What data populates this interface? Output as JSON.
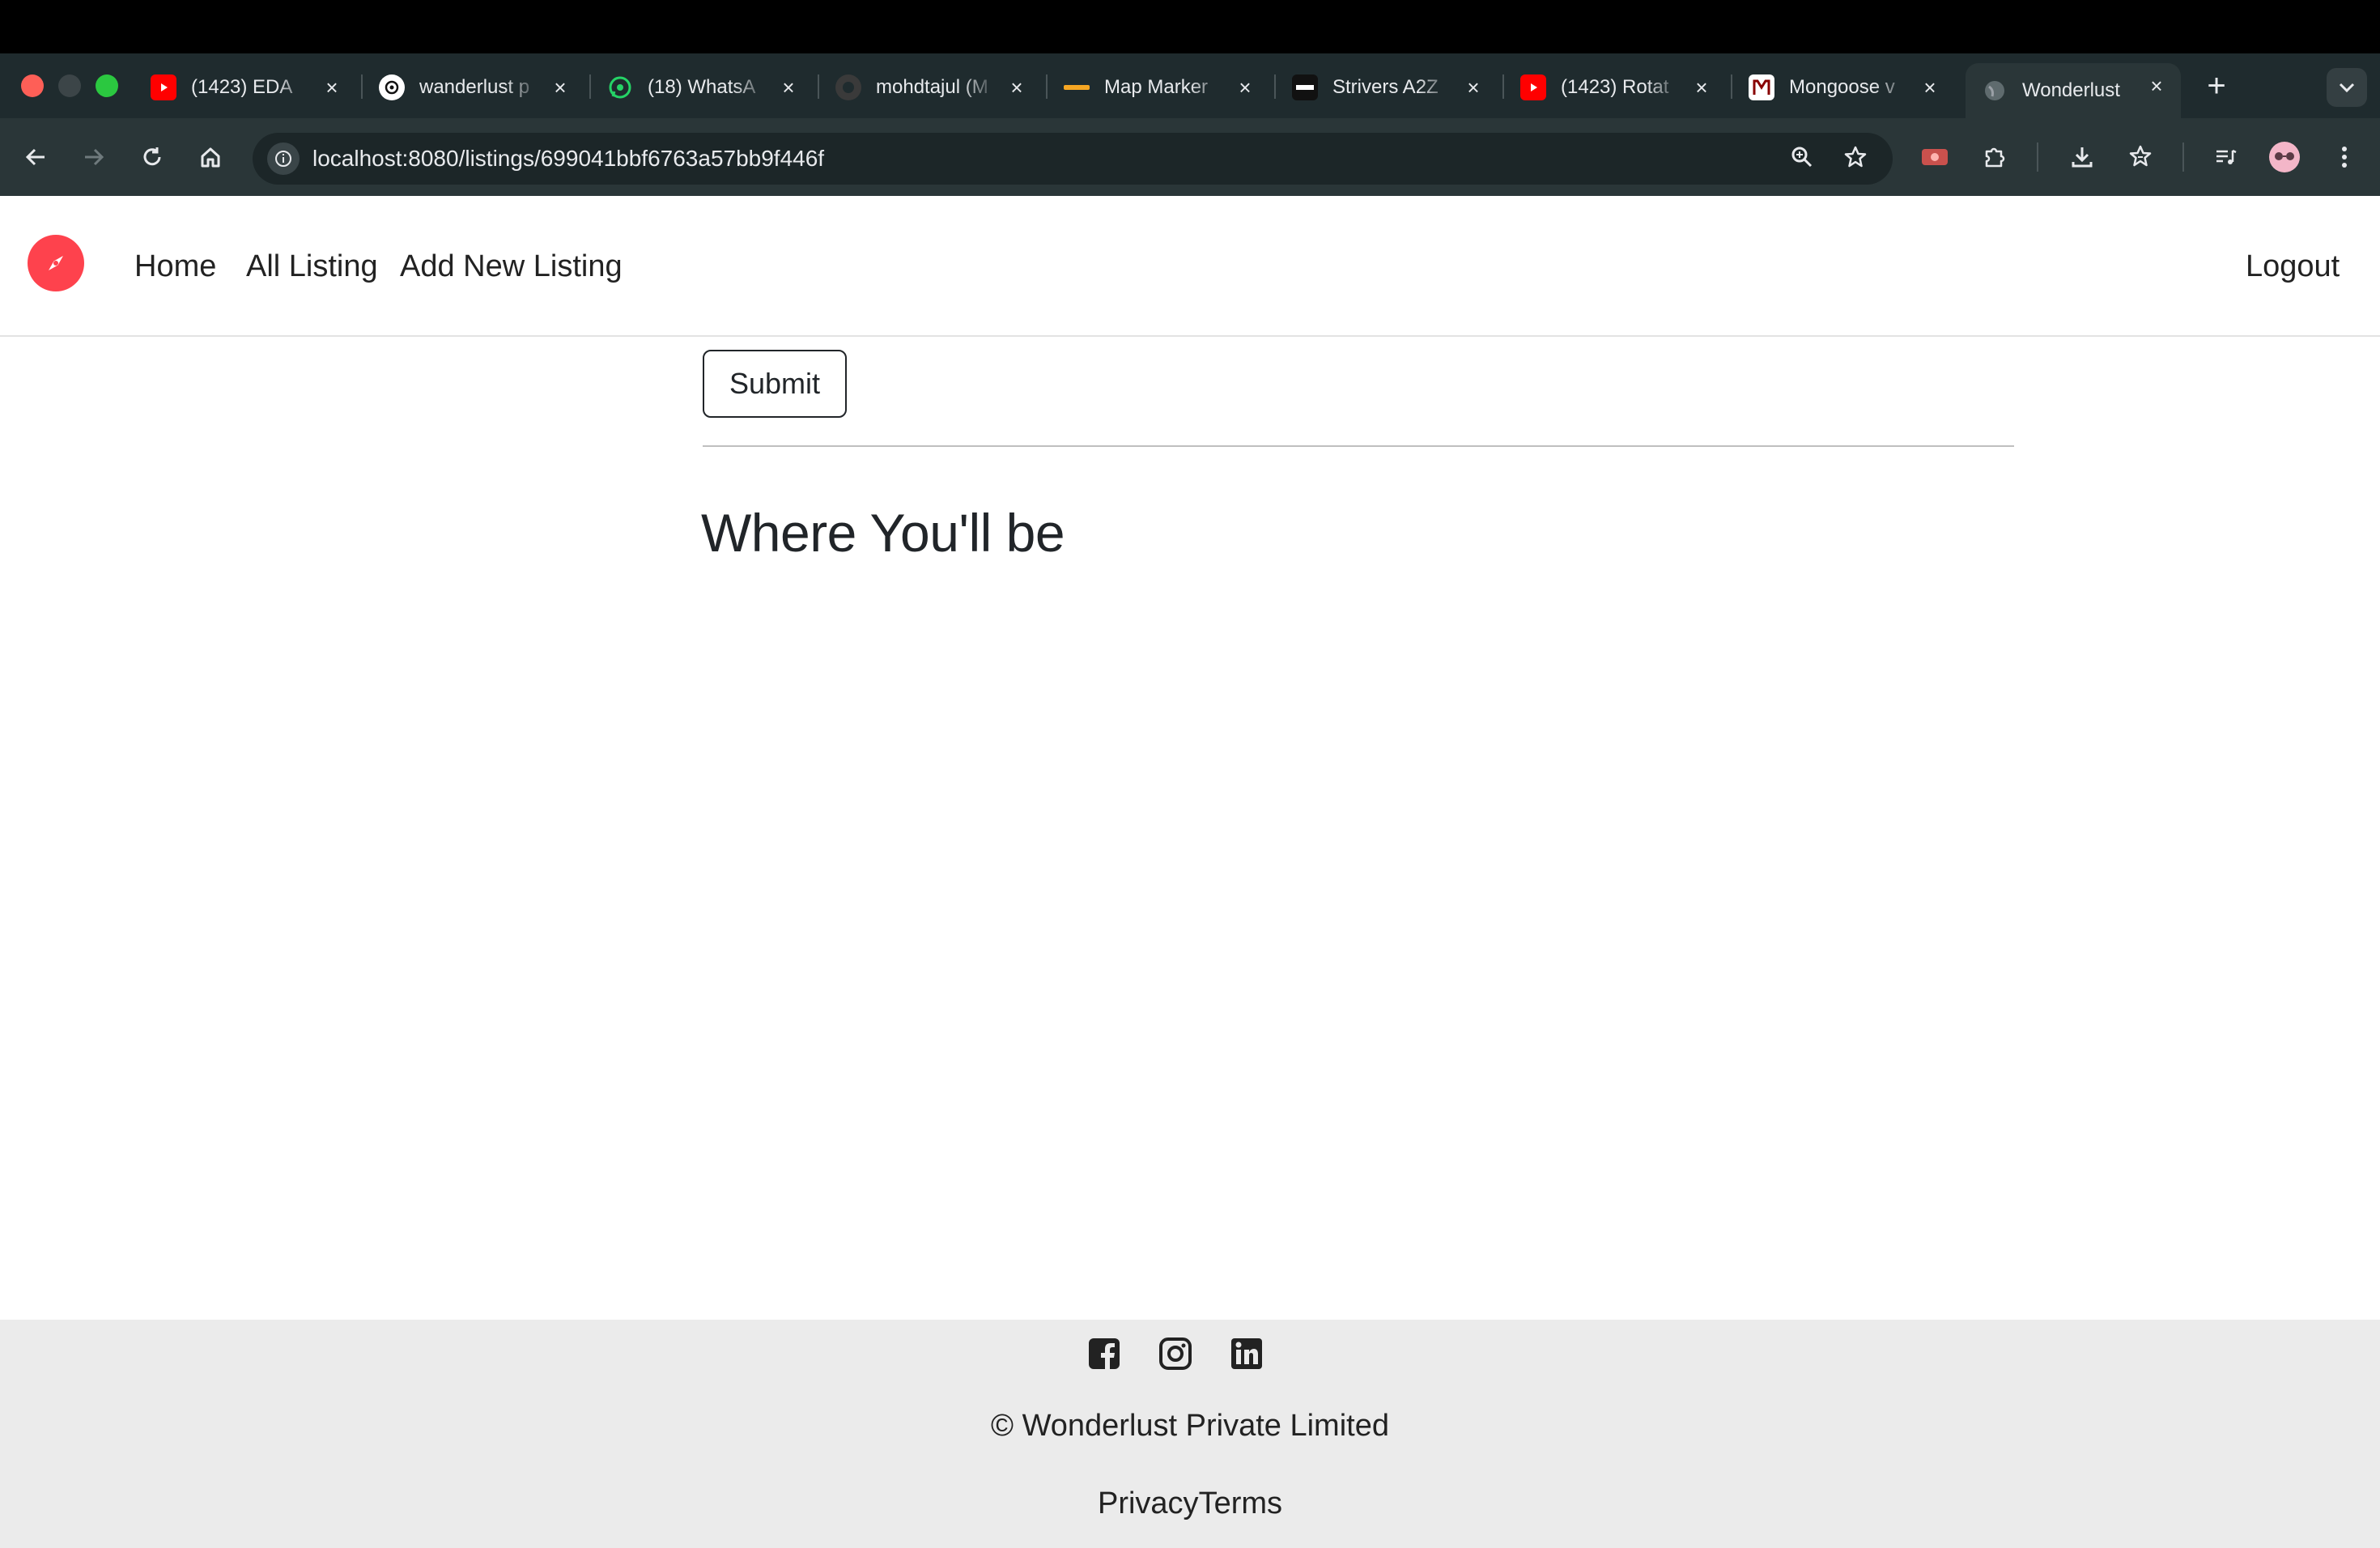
{
  "browser": {
    "tabs": [
      {
        "title": "(1423) EDA",
        "icon": "youtube-icon",
        "color": "#ff0000"
      },
      {
        "title": "wanderlust p",
        "icon": "chatgpt-icon",
        "color": "#ffffff"
      },
      {
        "title": "(18) WhatsA",
        "icon": "whatsapp-icon",
        "color": "#25d366"
      },
      {
        "title": "mohdtajul (M",
        "icon": "github-icon",
        "color": "#3a3a3a"
      },
      {
        "title": "Map Marker",
        "icon": "coursera-icon",
        "color": "#f5a623"
      },
      {
        "title": "Strivers A2Z",
        "icon": "tuf-icon",
        "color": "#111111"
      },
      {
        "title": "(1423) Rotat",
        "icon": "youtube-icon",
        "color": "#ff0000"
      },
      {
        "title": "Mongoose v",
        "icon": "mongoose-icon",
        "color": "#ffffff"
      },
      {
        "title": "Wonderlust",
        "icon": "globe-icon",
        "color": "#9aa0a6"
      }
    ],
    "url": "localhost:8080/listings/699041bbf6763a57bb9f446f"
  },
  "nav": {
    "links": [
      "Home",
      "All Listing",
      "Add New Listing"
    ],
    "logout": "Logout",
    "brand_color": "#fe424d"
  },
  "content": {
    "submit_label": "Submit",
    "section_heading": "Where You'll be"
  },
  "footer": {
    "socials": [
      "facebook-icon",
      "instagram-icon",
      "linkedin-icon"
    ],
    "copyright": "© Wonderlust Private Limited",
    "links": [
      "Privacy",
      "Terms"
    ]
  }
}
